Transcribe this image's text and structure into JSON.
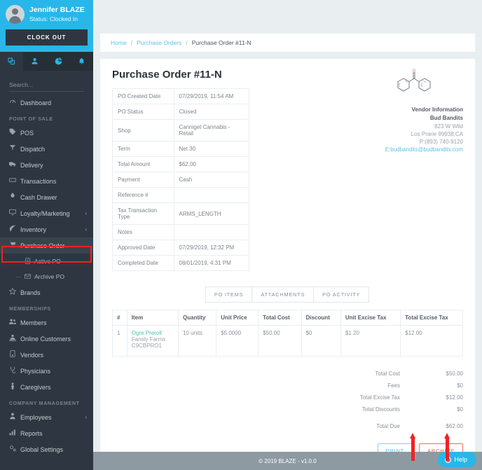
{
  "sidebar": {
    "profile": {
      "name": "Jennifer BLAZE",
      "status": "Status: Clocked In",
      "clock_button": "CLOCK OUT"
    },
    "icon_tabs": [
      {
        "name": "pages-icon",
        "glyph": "❐"
      },
      {
        "name": "user-icon",
        "glyph": "♟"
      },
      {
        "name": "chart-icon",
        "glyph": "◔"
      },
      {
        "name": "bell-icon",
        "glyph": "ὑ4"
      }
    ],
    "search_placeholder": "Search...",
    "dashboard": {
      "label": "Dashboard",
      "icon": "speedometer-icon"
    },
    "sections": [
      {
        "title": "POINT OF SALE",
        "items": [
          {
            "label": "POS",
            "icon": "tag-icon",
            "chevron": ""
          },
          {
            "label": "Dispatch",
            "icon": "dispatch-icon",
            "chevron": ""
          },
          {
            "label": "Delivery",
            "icon": "truck-icon",
            "chevron": ""
          },
          {
            "label": "Transactions",
            "icon": "transactions-icon",
            "chevron": ""
          },
          {
            "label": "Cash Drawer",
            "icon": "cash-icon",
            "chevron": ""
          },
          {
            "label": "Loyalty/Marketing",
            "icon": "monitor-icon",
            "chevron": "‹"
          },
          {
            "label": "Inventory",
            "icon": "leaf-icon",
            "chevron": "‹"
          },
          {
            "label": "Purchase Order",
            "icon": "cart-icon",
            "chevron": "⌄",
            "expanded": true
          },
          {
            "label": "Brands",
            "icon": "star-icon",
            "chevron": ""
          }
        ]
      },
      {
        "title": "MEMBERSHIPS",
        "items": [
          {
            "label": "Members",
            "icon": "members-icon",
            "chevron": ""
          },
          {
            "label": "Online Customers",
            "icon": "online-customers-icon",
            "chevron": ""
          },
          {
            "label": "Vendors",
            "icon": "vendor-icon",
            "chevron": ""
          },
          {
            "label": "Physicians",
            "icon": "physician-icon",
            "chevron": ""
          },
          {
            "label": "Caregivers",
            "icon": "caregiver-icon",
            "chevron": ""
          }
        ]
      },
      {
        "title": "COMPANY MANAGEMENT",
        "items": [
          {
            "label": "Employees",
            "icon": "employee-icon",
            "chevron": "‹"
          },
          {
            "label": "Reports",
            "icon": "reports-icon",
            "chevron": ""
          },
          {
            "label": "Global Settings",
            "icon": "settings-icon",
            "chevron": ""
          }
        ]
      }
    ],
    "purchase_order_children": [
      {
        "label": "Active PO",
        "icon": "active-po-icon",
        "highlighted": true
      },
      {
        "label": "Archive PO",
        "icon": "archive-po-icon",
        "highlighted": false
      }
    ]
  },
  "breadcrumb": {
    "home": "Home",
    "parent": "Purchase Orders",
    "current": "Purchase Order #11-N"
  },
  "page": {
    "title": "Purchase Order #11-N"
  },
  "info_rows": [
    {
      "key": "PO Created Date",
      "value": "07/29/2019, 11:54 AM"
    },
    {
      "key": "PO Status",
      "value": "Closed"
    },
    {
      "key": "Shop",
      "value": "Canniget Cannabis -Retail"
    },
    {
      "key": "Term",
      "value": "Net 30"
    },
    {
      "key": "Total Amount",
      "value": "$62.00"
    },
    {
      "key": "Payment",
      "value": "Cash"
    },
    {
      "key": "Reference #",
      "value": ""
    },
    {
      "key": "Tax Transaction Type",
      "value": "ARMS_LENGTH"
    },
    {
      "key": "Notes",
      "value": ""
    },
    {
      "key": "Approved Date",
      "value": "07/29/2019, 12:32 PM"
    },
    {
      "key": "Completed Date",
      "value": "08/01/2019, 4:31 PM"
    }
  ],
  "vendor": {
    "logo_icon": "benzophenone-molecule-icon",
    "heading": "Vendor Information",
    "name": "Bud Bandits",
    "address1": "823 W Wild",
    "address2": "Los Prarie 99938,CA",
    "phone": "P:(893) 740-9120",
    "email": "E:budbandits@budbandits.com"
  },
  "tabs": [
    {
      "label": "PO ITEMS",
      "active": true
    },
    {
      "label": "ATTACHMENTS",
      "active": false
    },
    {
      "label": "PO ACTIVITY",
      "active": false
    }
  ],
  "items_table": {
    "columns": [
      "#",
      "Item",
      "Quantity",
      "Unit Price",
      "Total Cost",
      "Discount",
      "Unit Excise Tax",
      "Total Excise Tax"
    ],
    "rows": [
      {
        "num": "1",
        "item_name": "Ogre Preroll",
        "item_brand": "Family Farms",
        "item_sku": "C9CBPRO1",
        "quantity": "10 units",
        "unit_price": "$5.0000",
        "total_cost": "$50.00",
        "discount": "$0",
        "unit_excise_tax": "$1.20",
        "total_excise_tax": "$12.00"
      }
    ]
  },
  "totals": [
    {
      "label": "Total Cost",
      "value": "$50.00"
    },
    {
      "label": "Fees",
      "value": "$0"
    },
    {
      "label": "Total Excise Tax",
      "value": "$12.00"
    },
    {
      "label": "Total Discounts",
      "value": "$0"
    },
    {
      "label": "Total Due",
      "value": "$62.00"
    }
  ],
  "actions": {
    "print": "PRINT",
    "archive": "ARCHIVE"
  },
  "footer": {
    "text": "© 2019 BLAZE - v1.0.0"
  },
  "help": {
    "label": "Help",
    "icon": "question-circle-icon",
    "glyph": "?"
  },
  "colors": {
    "accent": "#29b6e8",
    "sidebar": "#2e3741",
    "archive": "#ef5b4a",
    "annotation": "#f42121",
    "item_link": "#4cc5a2"
  }
}
